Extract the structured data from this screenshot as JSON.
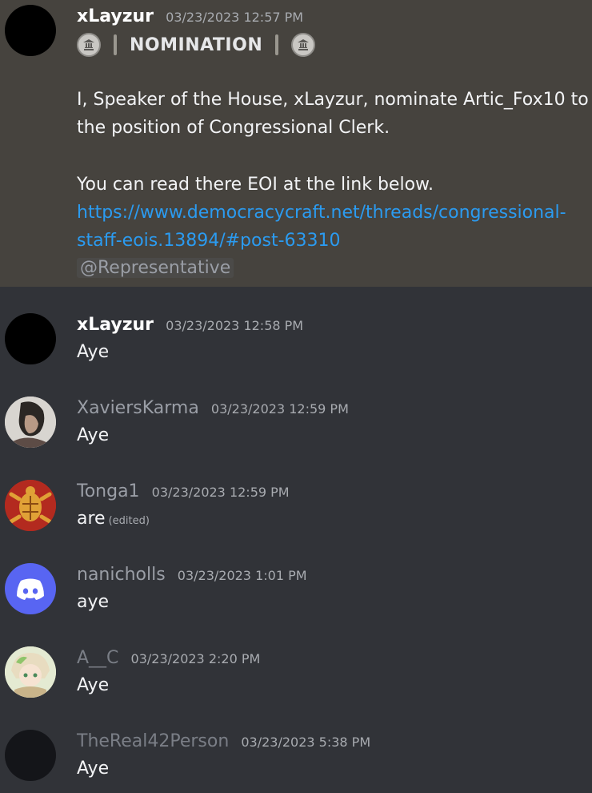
{
  "messages": [
    {
      "username": "xLayzur",
      "timestamp": "03/23/2023 12:57 PM",
      "user_color": "#ffffff",
      "highlighted": true,
      "nomination_title": "NOMINATION",
      "body_line1": "I, Speaker of the House, xLayzur, nominate Artic_Fox10 to",
      "body_line2": "the position of Congressional Clerk.",
      "body_line3": "You can read there EOI at the link below.",
      "link_line1": "https://www.democracycraft.net/threads/congressional-",
      "link_line2": "staff-eois.13894/#post-63310",
      "mention": "@Representative"
    },
    {
      "username": "xLayzur",
      "timestamp": "03/23/2023 12:58 PM",
      "text": "Aye",
      "user_color": "#ffffff"
    },
    {
      "username": "XaviersKarma",
      "timestamp": "03/23/2023 12:59 PM",
      "text": "Aye",
      "user_color": "#9a9ea6"
    },
    {
      "username": "Tonga1",
      "timestamp": "03/23/2023 12:59 PM",
      "text": "are",
      "edited": "(edited)",
      "user_color": "#9a9ea6"
    },
    {
      "username": "nanicholls",
      "timestamp": "03/23/2023 1:01 PM",
      "text": "aye",
      "user_color": "#9a9ea6"
    },
    {
      "username": "A__C",
      "timestamp": "03/23/2023 2:20 PM",
      "text": "Aye",
      "user_color": "#7a7e86"
    },
    {
      "username": "TheReal42Person",
      "timestamp": "03/23/2023 5:38 PM",
      "text": "Aye",
      "user_color": "#7a7e86"
    }
  ],
  "colors": {
    "background": "#313338",
    "highlight": "#46433e",
    "link": "#2b9bf0",
    "discord_blurple": "#5865f2"
  }
}
